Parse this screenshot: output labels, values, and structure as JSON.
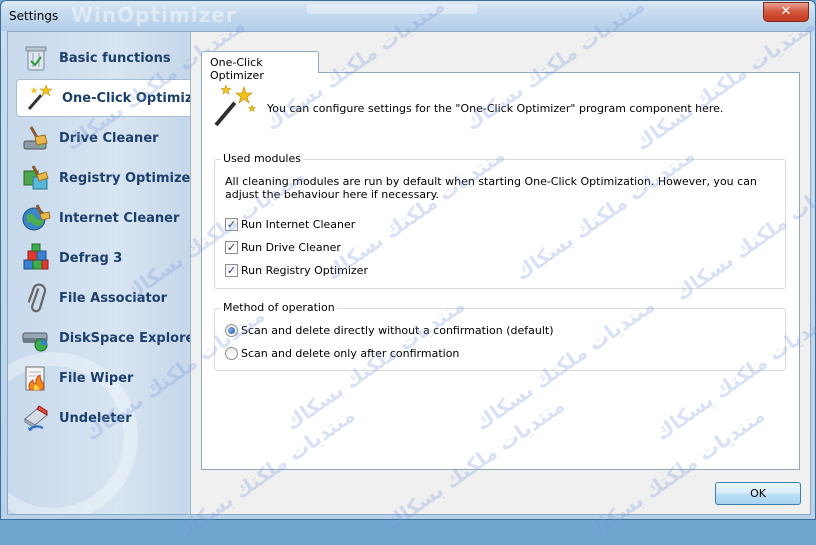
{
  "window": {
    "title": "Settings",
    "ghost_title": "WinOptimizer",
    "close_label": "✕"
  },
  "sidebar": {
    "items": [
      {
        "label": "Basic functions",
        "icon": "trash-icon"
      },
      {
        "label": "One-Click Optimizer",
        "icon": "magic-wand-icon"
      },
      {
        "label": "Drive Cleaner",
        "icon": "broom-drive-icon"
      },
      {
        "label": "Registry Optimizer",
        "icon": "registry-cubes-icon"
      },
      {
        "label": "Internet Cleaner",
        "icon": "globe-broom-icon"
      },
      {
        "label": "Defrag 3",
        "icon": "blocks-icon"
      },
      {
        "label": "File Associator",
        "icon": "paperclip-icon"
      },
      {
        "label": "DiskSpace Explorer",
        "icon": "disk-chart-icon"
      },
      {
        "label": "File Wiper",
        "icon": "fire-file-icon"
      },
      {
        "label": "Undeleter",
        "icon": "eraser-undo-icon"
      }
    ],
    "active_index": 1
  },
  "tab": {
    "label": "One-Click Optimizer"
  },
  "intro": {
    "text": "You can configure settings for the \"One-Click Optimizer\" program component here."
  },
  "modules": {
    "title": "Used modules",
    "description": "All cleaning modules are run by default when starting One-Click Optimization. However, you can adjust the behaviour here if necessary.",
    "options": [
      {
        "label": "Run Internet Cleaner",
        "checked": true
      },
      {
        "label": "Run Drive Cleaner",
        "checked": true
      },
      {
        "label": "Run Registry Optimizer",
        "checked": true
      }
    ]
  },
  "method": {
    "title": "Method of operation",
    "options": [
      {
        "label": "Scan and delete directly without a confirmation (default)",
        "selected": true
      },
      {
        "label": "Scan and delete only after confirmation",
        "selected": false
      }
    ]
  },
  "buttons": {
    "ok": "OK"
  },
  "watermark": {
    "text": "منتديات ملكتك بسكاك"
  },
  "colors": {
    "sidebar_text": "#1c3f6b",
    "close_button": "#c33a1f",
    "check_mark": "#1b3c78"
  }
}
